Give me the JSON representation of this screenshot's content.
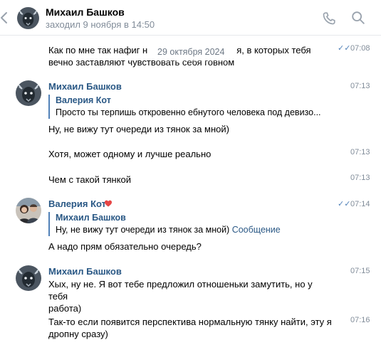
{
  "header": {
    "name": "Михаил Башков",
    "status": "заходил 9 ноября в 14:50",
    "back_icon": "chevron-left-icon",
    "call_icon": "phone-icon",
    "search_icon": "search-icon"
  },
  "date_divider": "29 октября 2024",
  "messages": [
    {
      "lines": [
        "Как по мне так нафиг н",
        "я, в которых тебя",
        "вечно заставляют чувствовать себя говном"
      ],
      "time": "07:08",
      "read": "✓✓"
    },
    {
      "author": "Михаил Башков",
      "time": "07:13",
      "quote_author": "Валерия Кот",
      "quote_text": "Просто ты терпишь откровенно ебнутого человека под девизо...",
      "text": "Ну, не вижу тут очереди из тянок за мной)"
    },
    {
      "text": "Хотя, может одному и лучше реально",
      "time": "07:13"
    },
    {
      "text": "Чем с такой тянкой",
      "time": "07:13"
    },
    {
      "author": "Валерия Кот",
      "time": "07:14",
      "read": "✓✓",
      "quote_author": "Михаил Башков",
      "quote_text": "Ну, не вижу тут очереди из тянок за мной)",
      "quote_link": "Сообщение",
      "text": "А надо прям обязательно очередь?"
    },
    {
      "author": "Михаил Башков",
      "time": "07:15",
      "lines": [
        "Хых, ну не. Я вот тебе предложил отношеньки замутить, но у тебя",
        "работа)"
      ]
    },
    {
      "time": "07:16",
      "lines": [
        "Так-то если появится перспектива нормальную тянку найти, эту я",
        "дропну сразу)"
      ]
    }
  ]
}
